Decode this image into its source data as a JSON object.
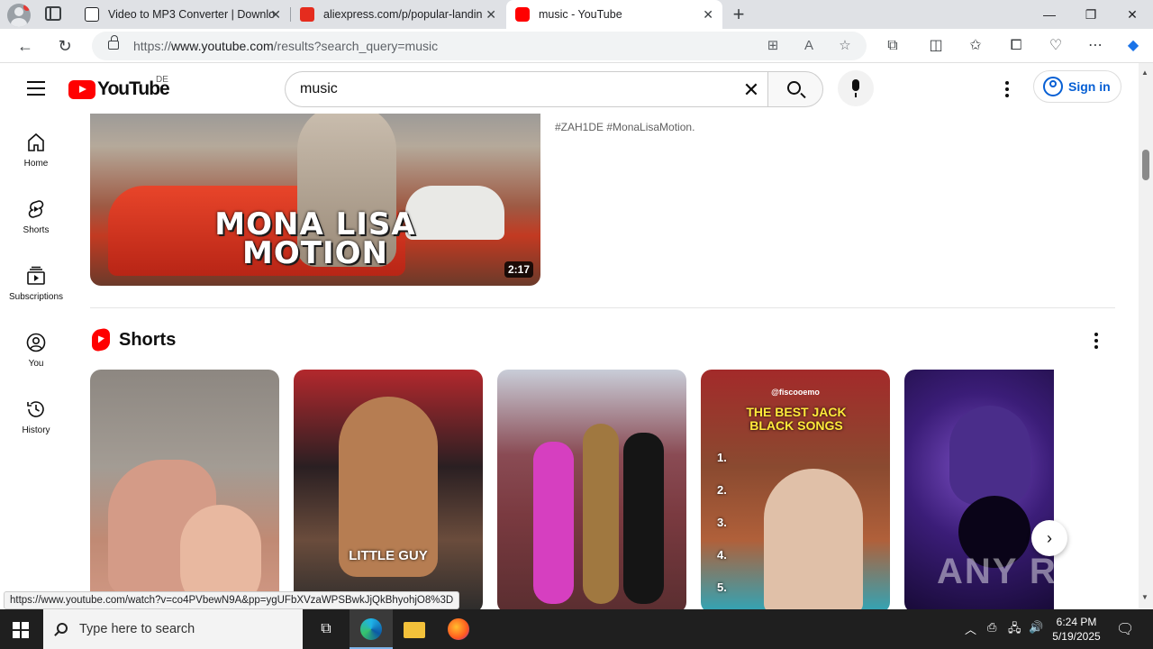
{
  "browser": {
    "tabs": [
      {
        "title": "Video to MP3 Converter | Downlo",
        "favicon_color": "#202124"
      },
      {
        "title": "aliexpress.com/p/popular-landin",
        "favicon_color": "#e52c1e"
      },
      {
        "title": "music - YouTube",
        "favicon_color": "#ff0000",
        "active": true
      }
    ],
    "url_prefix": "https://",
    "url_host": "www.youtube.com",
    "url_path": "/results?search_query=music",
    "status_url": "https://www.youtube.com/watch?v=co4PVbewN9A&pp=ygUFbXVzaWPSBwkJjQkBhyohjO8%3D"
  },
  "youtube": {
    "logo_text": "YouTube",
    "region": "DE",
    "search_value": "music",
    "signin_label": "Sign in",
    "guide": [
      {
        "label": "Home",
        "icon": "home-icon"
      },
      {
        "label": "Shorts",
        "icon": "shorts-icon"
      },
      {
        "label": "Subscriptions",
        "icon": "subscriptions-icon"
      },
      {
        "label": "You",
        "icon": "you-icon"
      },
      {
        "label": "History",
        "icon": "history-icon"
      }
    ],
    "video": {
      "thumb_line1": "MONA LISA",
      "thumb_line2": "MOTION",
      "duration": "2:17",
      "hashtags": "#ZAH1DE #MonaLisaMotion."
    },
    "shorts_title": "Shorts",
    "shorts": [
      {
        "label": ""
      },
      {
        "label": "LITTLE GUY"
      },
      {
        "label": ""
      },
      {
        "label": "THE BEST JACK BLACK SONGS",
        "handle": "@fiscooemo",
        "list": [
          "1.",
          "2.",
          "3.",
          "4.",
          "5."
        ]
      },
      {
        "label": ""
      }
    ],
    "brand_color": "#ff0000",
    "link_color": "#065fd4"
  },
  "watermark": "ANY RUN",
  "taskbar": {
    "search_placeholder": "Type here to search",
    "time": "6:24 PM",
    "date": "5/19/2025"
  }
}
